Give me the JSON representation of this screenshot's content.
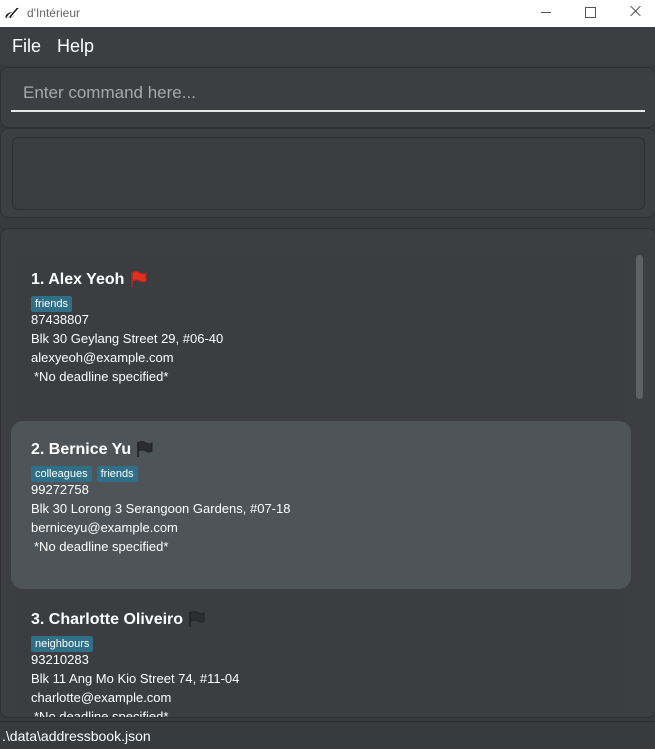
{
  "window": {
    "logo": "𝒹",
    "title": "d'Intérieur"
  },
  "menu": {
    "file": "File",
    "help": "Help"
  },
  "command": {
    "placeholder": "Enter command here...",
    "value": ""
  },
  "result": {
    "text": ""
  },
  "persons": [
    {
      "index": "1.",
      "name": "Alex Yeoh",
      "flag_color": "#e0301e",
      "tags": [
        "friends"
      ],
      "phone": "87438807",
      "address": "Blk 30 Geylang Street 29, #06-40",
      "email": "alexyeoh@example.com",
      "deadline": "*No deadline specified*"
    },
    {
      "index": "2.",
      "name": "Bernice Yu",
      "flag_color": "#2b2d30",
      "tags": [
        "colleagues",
        "friends"
      ],
      "phone": "99272758",
      "address": "Blk 30 Lorong 3 Serangoon Gardens, #07-18",
      "email": "berniceyu@example.com",
      "deadline": "*No deadline specified*"
    },
    {
      "index": "3.",
      "name": "Charlotte Oliveiro",
      "flag_color": "#2b2d30",
      "tags": [
        "neighbours"
      ],
      "phone": "93210283",
      "address": "Blk 11 Ang Mo Kio Street 74, #11-04",
      "email": "charlotte@example.com",
      "deadline": "*No deadline specified*"
    }
  ],
  "status": {
    "path": ".\\data\\addressbook.json"
  }
}
